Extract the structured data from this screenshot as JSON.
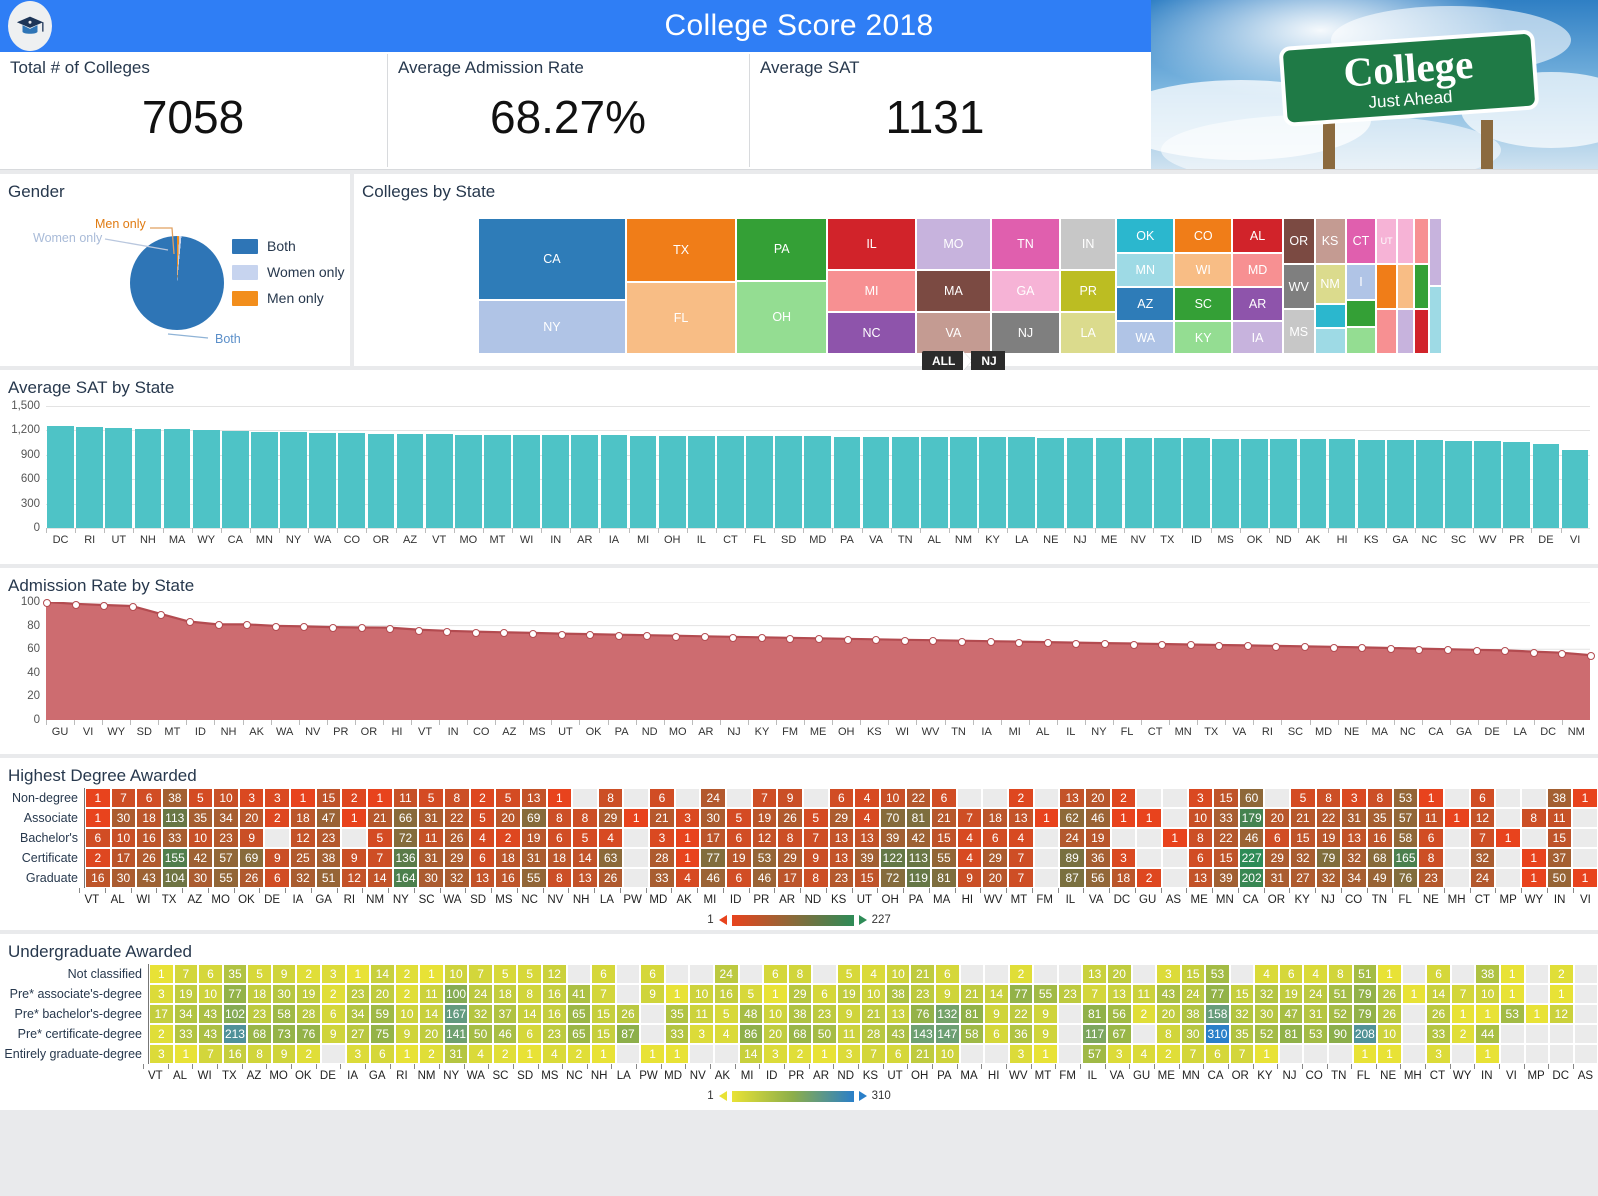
{
  "header": {
    "title": "College Score 2018",
    "logo_icon": "graduation-cap-icon",
    "banner_text_main": "College",
    "banner_text_sub": "Just Ahead",
    "kpis": [
      {
        "label": "Total # of Colleges",
        "value": "7058"
      },
      {
        "label": "Average Admission Rate",
        "value": "68.27%"
      },
      {
        "label": "Average SAT",
        "value": "1131"
      }
    ]
  },
  "gender": {
    "title": "Gender",
    "callouts": {
      "men": "Men only",
      "women": "Women only",
      "both": "Both"
    },
    "legend": [
      {
        "label": "Both",
        "color": "#2e75b6"
      },
      {
        "label": "Women only",
        "color": "#c7d4ef"
      },
      {
        "label": "Men only",
        "color": "#f28e1c"
      }
    ]
  },
  "states_panel": {
    "title": "Colleges by State",
    "breadcrumb": [
      "ALL",
      "NJ"
    ]
  },
  "chart_data": [
    {
      "type": "pie",
      "title": "Gender",
      "categories": [
        "Both",
        "Women only",
        "Men only"
      ],
      "values": [
        98.5,
        0.78,
        0.72
      ],
      "colors": [
        "#2e75b6",
        "#c7d4ef",
        "#f28e1c"
      ],
      "legend_position": "right"
    },
    {
      "type": "treemap",
      "title": "Colleges by State",
      "labels": [
        "CA",
        "NY",
        "TX",
        "FL",
        "PA",
        "OH",
        "IL",
        "MI",
        "NC",
        "MO",
        "MA",
        "VA",
        "TN",
        "GA",
        "NJ",
        "IN",
        "PR",
        "LA",
        "OK",
        "MN",
        "AZ",
        "WA",
        "CO",
        "WI",
        "SC",
        "KY",
        "AL",
        "MD",
        "AR",
        "IA",
        "OR",
        "WV",
        "MS",
        "KS",
        "NM",
        "CT",
        "UT"
      ],
      "colors": [
        "#2e7cb8",
        "#b0c4e6",
        "#f07d18",
        "#f8bd85",
        "#34a036",
        "#94dd92",
        "#d1232a",
        "#f79092",
        "#8e54ab",
        "#c7b3dd",
        "#7b4a42",
        "#c49b92",
        "#e05fae",
        "#f6b3d6",
        "#7f7f7f",
        "#c7c7c7",
        "#bcbd22",
        "#dbdb8d",
        "#2bb7ce",
        "#9edae5",
        "#2e7cb8",
        "#b0c4e6",
        "#f07d18",
        "#f8bd85",
        "#34a036",
        "#94dd92",
        "#d1232a",
        "#f79092",
        "#8e54ab",
        "#c7b3dd",
        "#7b4a42",
        "#7f7f7f",
        "#c7c7c7",
        "#c49b92",
        "#dbdb8d",
        "#e05fae",
        "#f6b3d6"
      ]
    },
    {
      "type": "bar",
      "title": "Average SAT by State",
      "xlabel": "",
      "ylabel": "",
      "ylim": [
        0,
        1500
      ],
      "yticks": [
        "0",
        "300",
        "600",
        "900",
        "1,200",
        "1,500"
      ],
      "grid": true,
      "color": "#4ec3c6",
      "categories": [
        "DC",
        "RI",
        "UT",
        "NH",
        "MA",
        "WY",
        "CA",
        "MN",
        "NY",
        "WA",
        "CO",
        "OR",
        "AZ",
        "VT",
        "MO",
        "MT",
        "WI",
        "IN",
        "AR",
        "IA",
        "MI",
        "OH",
        "IL",
        "CT",
        "FL",
        "SD",
        "MD",
        "PA",
        "VA",
        "TN",
        "AL",
        "NM",
        "KY",
        "LA",
        "NE",
        "NJ",
        "ME",
        "NV",
        "TX",
        "ID",
        "MS",
        "OK",
        "ND",
        "AK",
        "HI",
        "KS",
        "GA",
        "NC",
        "SC",
        "WV",
        "PR",
        "DE",
        "VI"
      ],
      "values": [
        1255,
        1238,
        1228,
        1220,
        1214,
        1202,
        1188,
        1182,
        1180,
        1174,
        1171,
        1162,
        1158,
        1152,
        1148,
        1146,
        1144,
        1142,
        1140,
        1139,
        1137,
        1136,
        1134,
        1132,
        1130,
        1128,
        1127,
        1125,
        1123,
        1121,
        1120,
        1118,
        1116,
        1114,
        1112,
        1110,
        1108,
        1106,
        1104,
        1102,
        1100,
        1098,
        1096,
        1094,
        1090,
        1086,
        1082,
        1078,
        1072,
        1066,
        1058,
        1030,
        960
      ]
    },
    {
      "type": "area",
      "title": "Admission Rate by State",
      "xlabel": "",
      "ylabel": "",
      "ylim": [
        0,
        100
      ],
      "yticks": [
        "0",
        "20",
        "40",
        "60",
        "80",
        "100"
      ],
      "grid": true,
      "color": "#c15a5e",
      "fill": "#cd6c70",
      "categories": [
        "GU",
        "VI",
        "WY",
        "SD",
        "MT",
        "ID",
        "NH",
        "AK",
        "WA",
        "NV",
        "PR",
        "OR",
        "HI",
        "VT",
        "IN",
        "CO",
        "AZ",
        "MS",
        "UT",
        "OK",
        "PA",
        "ND",
        "MO",
        "AR",
        "NJ",
        "KY",
        "FM",
        "ME",
        "OH",
        "KS",
        "WI",
        "WV",
        "TN",
        "IA",
        "MI",
        "AL",
        "IL",
        "NY",
        "FL",
        "CT",
        "MN",
        "TX",
        "VA",
        "RI",
        "SC",
        "MD",
        "NE",
        "MA",
        "NC",
        "CA",
        "GA",
        "DE",
        "LA",
        "DC",
        "NM"
      ],
      "values": [
        100,
        98.5,
        97.5,
        96.6,
        90,
        83.5,
        81,
        81,
        79.8,
        79.3,
        78.7,
        78.4,
        78.3,
        76.6,
        75.6,
        74.9,
        74.3,
        73.8,
        73.2,
        72.8,
        72.3,
        71.9,
        71.4,
        70.9,
        70.5,
        70.1,
        69.7,
        69.2,
        68.8,
        68.4,
        68,
        67.6,
        67.2,
        66.8,
        66.4,
        66,
        65.6,
        65.2,
        64.8,
        64.4,
        64,
        63.6,
        63.2,
        62.8,
        62.4,
        62,
        61.5,
        61,
        60.5,
        60,
        59.5,
        59,
        58,
        57,
        55
      ]
    },
    {
      "type": "heatmap",
      "title": "Highest Degree Awarded",
      "rows": [
        "Non-degree",
        "Associate",
        "Bachelor's",
        "Certificate",
        "Graduate"
      ],
      "columns": [
        "VT",
        "AL",
        "WI",
        "TX",
        "AZ",
        "MO",
        "OK",
        "DE",
        "IA",
        "GA",
        "RI",
        "NM",
        "NY",
        "SC",
        "WA",
        "SD",
        "MS",
        "NC",
        "NV",
        "NH",
        "LA",
        "PW",
        "MD",
        "AK",
        "MI",
        "ID",
        "PR",
        "AR",
        "ND",
        "KS",
        "UT",
        "OH",
        "PA",
        "MA",
        "HI",
        "WV",
        "MT",
        "FM",
        "IL",
        "VA",
        "DC",
        "GU",
        "AS",
        "ME",
        "MN",
        "CA",
        "OR",
        "KY",
        "NJ",
        "CO",
        "TN",
        "FL",
        "NE",
        "MH",
        "CT",
        "MP",
        "WY",
        "IN",
        "VI"
      ],
      "values": [
        [
          1,
          7,
          6,
          38,
          5,
          10,
          3,
          3,
          1,
          15,
          2,
          1,
          11,
          5,
          8,
          2,
          5,
          13,
          1,
          null,
          8,
          null,
          6,
          null,
          24,
          null,
          7,
          9,
          null,
          6,
          4,
          10,
          22,
          6,
          null,
          null,
          2,
          null,
          13,
          20,
          2,
          null,
          null,
          3,
          15,
          60,
          null,
          5,
          8,
          3,
          8,
          53,
          1,
          null,
          6,
          null,
          null,
          38,
          1
        ],
        [
          1,
          30,
          18,
          113,
          35,
          34,
          20,
          2,
          18,
          47,
          1,
          21,
          66,
          31,
          22,
          5,
          20,
          69,
          8,
          8,
          29,
          1,
          21,
          3,
          30,
          5,
          19,
          26,
          5,
          29,
          4,
          70,
          81,
          21,
          7,
          18,
          13,
          1,
          62,
          46,
          1,
          1,
          null,
          10,
          33,
          179,
          20,
          21,
          22,
          31,
          35,
          57,
          11,
          1,
          12,
          null,
          8,
          11,
          null
        ],
        [
          6,
          10,
          16,
          33,
          10,
          23,
          9,
          null,
          12,
          23,
          null,
          5,
          72,
          11,
          26,
          4,
          2,
          19,
          6,
          5,
          4,
          null,
          3,
          1,
          17,
          6,
          12,
          8,
          7,
          13,
          13,
          39,
          42,
          15,
          4,
          6,
          4,
          null,
          24,
          19,
          null,
          null,
          1,
          8,
          22,
          46,
          6,
          15,
          19,
          13,
          16,
          58,
          6,
          null,
          7,
          1,
          null,
          15,
          null
        ],
        [
          2,
          17,
          26,
          155,
          42,
          57,
          69,
          9,
          25,
          38,
          9,
          7,
          136,
          31,
          29,
          6,
          18,
          31,
          18,
          14,
          63,
          null,
          28,
          1,
          77,
          19,
          53,
          29,
          9,
          13,
          39,
          122,
          113,
          55,
          4,
          29,
          7,
          null,
          89,
          36,
          3,
          null,
          null,
          6,
          15,
          227,
          29,
          32,
          79,
          32,
          68,
          165,
          8,
          null,
          32,
          null,
          1,
          37,
          null
        ],
        [
          16,
          30,
          43,
          104,
          30,
          55,
          26,
          6,
          32,
          51,
          12,
          14,
          164,
          30,
          32,
          13,
          16,
          55,
          8,
          13,
          26,
          null,
          33,
          4,
          46,
          6,
          46,
          17,
          8,
          23,
          15,
          72,
          119,
          81,
          9,
          20,
          7,
          null,
          87,
          56,
          18,
          2,
          null,
          13,
          39,
          202,
          31,
          27,
          32,
          34,
          49,
          76,
          23,
          null,
          24,
          null,
          1,
          50,
          1
        ]
      ],
      "legend_min": "1",
      "legend_max": "227",
      "legend_colors": [
        "#e8431d",
        "#8a6a3a",
        "#2e8b57"
      ]
    },
    {
      "type": "heatmap",
      "title": "Undergraduate Awarded",
      "rows": [
        "Not classified",
        "Pre* associate's-degree",
        "Pre* bachelor's-degree",
        "Pre* certificate-degree",
        "Entirely graduate-degree"
      ],
      "columns": [
        "VT",
        "AL",
        "WI",
        "TX",
        "AZ",
        "MO",
        "OK",
        "DE",
        "IA",
        "GA",
        "RI",
        "NM",
        "NY",
        "WA",
        "SC",
        "SD",
        "MS",
        "NC",
        "NH",
        "LA",
        "PW",
        "MD",
        "NV",
        "AK",
        "MI",
        "ID",
        "PR",
        "AR",
        "ND",
        "KS",
        "UT",
        "OH",
        "PA",
        "MA",
        "HI",
        "WV",
        "MT",
        "FM",
        "IL",
        "VA",
        "GU",
        "ME",
        "MN",
        "CA",
        "OR",
        "KY",
        "NJ",
        "CO",
        "TN",
        "FL",
        "NE",
        "MH",
        "CT",
        "WY",
        "IN",
        "VI",
        "MP",
        "DC",
        "AS"
      ],
      "values": [
        [
          1,
          7,
          6,
          35,
          5,
          9,
          2,
          3,
          1,
          14,
          2,
          1,
          10,
          7,
          5,
          5,
          12,
          null,
          6,
          null,
          6,
          null,
          null,
          24,
          null,
          6,
          8,
          null,
          5,
          4,
          10,
          21,
          6,
          null,
          null,
          2,
          null,
          null,
          13,
          20,
          null,
          3,
          15,
          53,
          null,
          4,
          6,
          4,
          8,
          51,
          1,
          null,
          6,
          null,
          38,
          1,
          null,
          2,
          null
        ],
        [
          3,
          19,
          10,
          77,
          18,
          30,
          19,
          2,
          23,
          20,
          2,
          11,
          100,
          24,
          18,
          8,
          16,
          41,
          7,
          null,
          9,
          1,
          10,
          16,
          5,
          1,
          29,
          6,
          19,
          10,
          38,
          23,
          9,
          21,
          14,
          77,
          55,
          23,
          7,
          13,
          11,
          43,
          24,
          77,
          15,
          32,
          19,
          24,
          51,
          79,
          26,
          1,
          14,
          7,
          10,
          1,
          null,
          1,
          null
        ],
        [
          17,
          34,
          43,
          102,
          23,
          58,
          28,
          6,
          34,
          59,
          10,
          14,
          167,
          32,
          37,
          14,
          16,
          65,
          15,
          26,
          null,
          35,
          11,
          5,
          48,
          10,
          38,
          23,
          9,
          21,
          13,
          76,
          132,
          81,
          9,
          22,
          9,
          null,
          81,
          56,
          2,
          20,
          38,
          158,
          32,
          30,
          47,
          31,
          52,
          79,
          26,
          null,
          26,
          1,
          1,
          53,
          1,
          12,
          null
        ],
        [
          2,
          33,
          43,
          213,
          68,
          73,
          76,
          9,
          27,
          75,
          9,
          20,
          141,
          50,
          46,
          6,
          23,
          65,
          15,
          87,
          null,
          33,
          3,
          4,
          86,
          20,
          68,
          50,
          11,
          28,
          43,
          143,
          147,
          58,
          6,
          36,
          9,
          null,
          117,
          67,
          null,
          8,
          30,
          310,
          35,
          52,
          81,
          53,
          90,
          208,
          10,
          null,
          33,
          2,
          44,
          null,
          null,
          null,
          null
        ],
        [
          3,
          1,
          7,
          16,
          8,
          9,
          2,
          null,
          3,
          6,
          1,
          2,
          31,
          4,
          2,
          1,
          4,
          2,
          1,
          null,
          1,
          1,
          null,
          null,
          14,
          3,
          2,
          1,
          3,
          7,
          6,
          21,
          10,
          null,
          null,
          3,
          1,
          null,
          57,
          3,
          4,
          2,
          7,
          6,
          7,
          1,
          null,
          null,
          null,
          1,
          1,
          null,
          3,
          null,
          1,
          null,
          null,
          null,
          null
        ]
      ],
      "legend_min": "1",
      "legend_max": "310",
      "legend_colors": [
        "#e8e236",
        "#8cae4a",
        "#2a7fc9"
      ]
    }
  ]
}
